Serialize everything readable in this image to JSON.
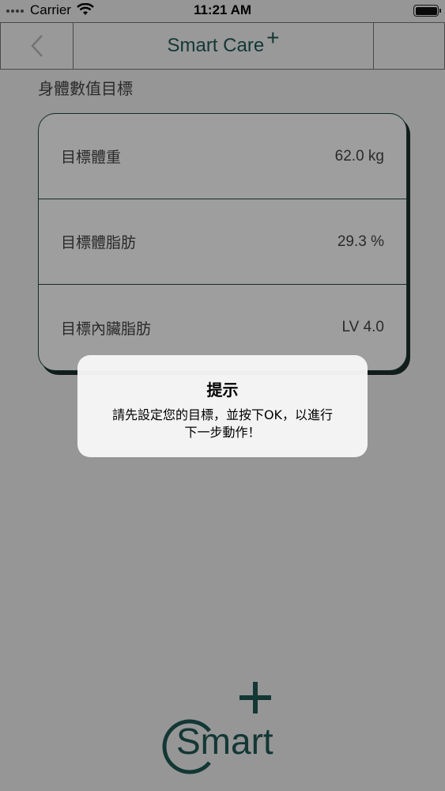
{
  "status_bar": {
    "carrier": "Carrier",
    "time": "11:21 AM"
  },
  "nav": {
    "title": "Smart Care",
    "title_plus": "+"
  },
  "section_title": "身體數值目標",
  "goals": [
    {
      "label": "目標體重",
      "value": "62.0 kg"
    },
    {
      "label": "目標體脂肪",
      "value": "29.3 %"
    },
    {
      "label": "目標內臟脂肪",
      "value": "LV 4.0"
    }
  ],
  "logo": {
    "text": "Smart"
  },
  "alert": {
    "title": "提示",
    "message_line1": "請先設定您的目標，並按下OK，以進行",
    "message_line2": "下一步動作！"
  },
  "colors": {
    "brand": "#1f5a54",
    "overlay": "#000000"
  }
}
